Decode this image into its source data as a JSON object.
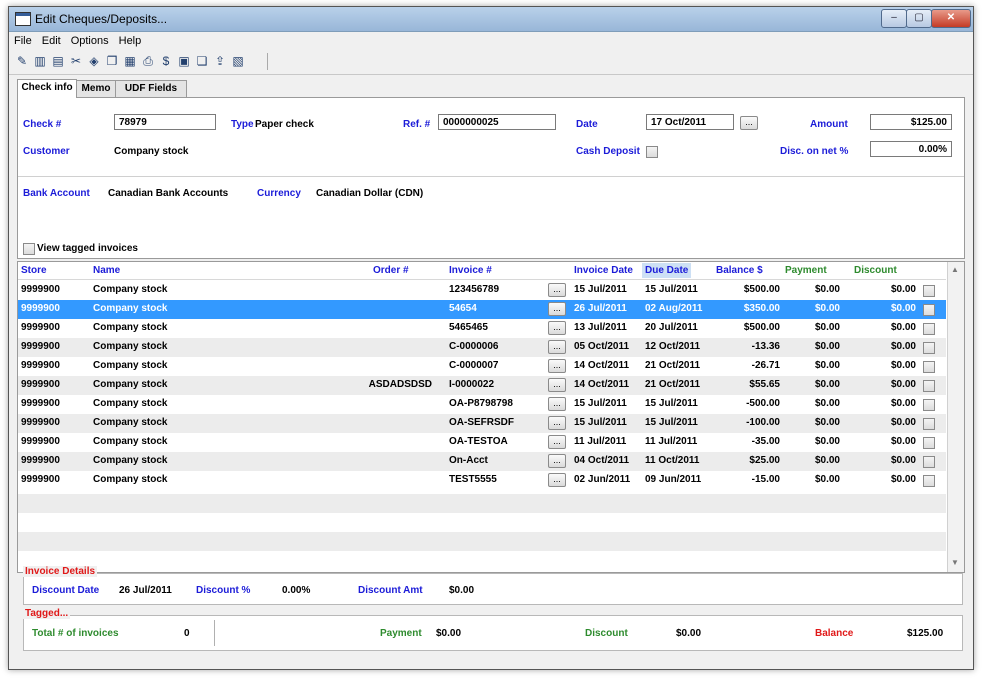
{
  "window": {
    "title": "Edit Cheques/Deposits...",
    "controls": {
      "minimize": "–",
      "maximize": "▢",
      "close": "✕"
    }
  },
  "menu": [
    "File",
    "Edit",
    "Options",
    "Help"
  ],
  "toolbar_icons": [
    "pencil-icon",
    "columns-icon",
    "card-icon",
    "cut-icon",
    "stamp-icon",
    "copy-icon",
    "grid-icon",
    "print-icon",
    "money-icon",
    "document-icon",
    "paste-icon",
    "export-icon",
    "report-icon"
  ],
  "tabs": [
    "Check info",
    "Memo",
    "UDF Fields"
  ],
  "check": {
    "check_label": "Check #",
    "check_value": "78979",
    "type_label": "Type",
    "type_value": "Paper check",
    "ref_label": "Ref. #",
    "ref_value": "0000000025",
    "date_label": "Date",
    "date_value": "17 Oct/2011",
    "amount_label": "Amount",
    "amount_value": "$125.00",
    "customer_label": "Customer",
    "customer_value": "Company stock",
    "cash_label": "Cash Deposit",
    "disc_label": "Disc. on net %",
    "disc_value": "0.00%",
    "bank_label": "Bank Account",
    "bank_value": "Canadian Bank Accounts",
    "currency_label": "Currency",
    "currency_value": "Canadian Dollar (CDN)",
    "view_tagged_label": "View tagged invoices",
    "dots": "..."
  },
  "grid": {
    "headers": {
      "store": "Store",
      "name": "Name",
      "order": "Order #",
      "invoice": "Invoice #",
      "invdate": "Invoice Date",
      "duedate": "Due Date",
      "balance": "Balance $",
      "payment": "Payment",
      "discount": "Discount"
    },
    "header_colors": {
      "blue": "#1c1cd8",
      "green": "#2e8b2e"
    },
    "rows": [
      {
        "store": "9999900",
        "name": "Company stock",
        "order": "",
        "invoice": "123456789",
        "invdate": "15 Jul/2011",
        "duedate": "15 Jul/2011",
        "balance": "$500.00",
        "payment": "$0.00",
        "discount": "$0.00"
      },
      {
        "store": "9999900",
        "name": "Company stock",
        "order": "",
        "invoice": "54654",
        "invdate": "26 Jul/2011",
        "duedate": "02 Aug/2011",
        "balance": "$350.00",
        "payment": "$0.00",
        "discount": "$0.00"
      },
      {
        "store": "9999900",
        "name": "Company stock",
        "order": "",
        "invoice": "5465465",
        "invdate": "13 Jul/2011",
        "duedate": "20 Jul/2011",
        "balance": "$500.00",
        "payment": "$0.00",
        "discount": "$0.00"
      },
      {
        "store": "9999900",
        "name": "Company stock",
        "order": "",
        "invoice": "C-0000006",
        "invdate": "05 Oct/2011",
        "duedate": "12 Oct/2011",
        "balance": "-13.36",
        "payment": "$0.00",
        "discount": "$0.00"
      },
      {
        "store": "9999900",
        "name": "Company stock",
        "order": "",
        "invoice": "C-0000007",
        "invdate": "14 Oct/2011",
        "duedate": "21 Oct/2011",
        "balance": "-26.71",
        "payment": "$0.00",
        "discount": "$0.00"
      },
      {
        "store": "9999900",
        "name": "Company stock",
        "order": "ASDADSDSD",
        "invoice": "I-0000022",
        "invdate": "14 Oct/2011",
        "duedate": "21 Oct/2011",
        "balance": "$55.65",
        "payment": "$0.00",
        "discount": "$0.00"
      },
      {
        "store": "9999900",
        "name": "Company stock",
        "order": "",
        "invoice": "OA-P8798798",
        "invdate": "15 Jul/2011",
        "duedate": "15 Jul/2011",
        "balance": "-500.00",
        "payment": "$0.00",
        "discount": "$0.00"
      },
      {
        "store": "9999900",
        "name": "Company stock",
        "order": "",
        "invoice": "OA-SEFRSDF",
        "invdate": "15 Jul/2011",
        "duedate": "15 Jul/2011",
        "balance": "-100.00",
        "payment": "$0.00",
        "discount": "$0.00"
      },
      {
        "store": "9999900",
        "name": "Company stock",
        "order": "",
        "invoice": "OA-TESTOA",
        "invdate": "11 Jul/2011",
        "duedate": "11 Jul/2011",
        "balance": "-35.00",
        "payment": "$0.00",
        "discount": "$0.00"
      },
      {
        "store": "9999900",
        "name": "Company stock",
        "order": "",
        "invoice": "On-Acct",
        "invdate": "04 Oct/2011",
        "duedate": "11 Oct/2011",
        "balance": "$25.00",
        "payment": "$0.00",
        "discount": "$0.00"
      },
      {
        "store": "9999900",
        "name": "Company stock",
        "order": "",
        "invoice": "TEST5555",
        "invdate": "02 Jun/2011",
        "duedate": "09 Jun/2011",
        "balance": "-15.00",
        "payment": "$0.00",
        "discount": "$0.00"
      }
    ],
    "selected_row": 1
  },
  "invoice_details": {
    "title": "Invoice Details",
    "discount_date_label": "Discount Date",
    "discount_date_value": "26 Jul/2011",
    "discount_pct_label": "Discount %",
    "discount_pct_value": "0.00%",
    "discount_amt_label": "Discount Amt",
    "discount_amt_value": "$0.00"
  },
  "tagged": {
    "title": "Tagged...",
    "total_label": "Total # of invoices",
    "total_value": "0",
    "payment_label": "Payment",
    "payment_value": "$0.00",
    "discount_label": "Discount",
    "discount_value": "$0.00",
    "balance_label": "Balance",
    "balance_value": "$125.00"
  }
}
